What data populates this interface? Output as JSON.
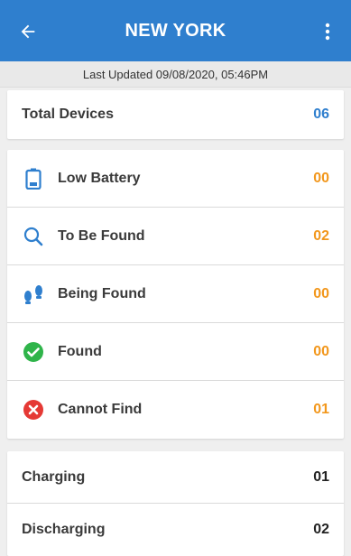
{
  "header": {
    "title": "NEW YORK",
    "last_updated": "Last Updated 09/08/2020, 05:46PM"
  },
  "summary": {
    "label": "Total Devices",
    "value": "06"
  },
  "status_items": [
    {
      "label": "Low Battery",
      "value": "00",
      "icon": "battery-icon"
    },
    {
      "label": "To Be Found",
      "value": "02",
      "icon": "search-icon"
    },
    {
      "label": "Being Found",
      "value": "00",
      "icon": "footprints-icon"
    },
    {
      "label": "Found",
      "value": "00",
      "icon": "check-circle-icon"
    },
    {
      "label": "Cannot Find",
      "value": "01",
      "icon": "error-circle-icon"
    }
  ],
  "power_items": [
    {
      "label": "Charging",
      "value": "01"
    },
    {
      "label": "Discharging",
      "value": "02"
    }
  ],
  "colors": {
    "appbar": "#2f7fce",
    "accent_orange": "#f2971c",
    "accent_blue": "#2f7fce",
    "found_green": "#2fb44a",
    "error_red": "#e53935"
  }
}
